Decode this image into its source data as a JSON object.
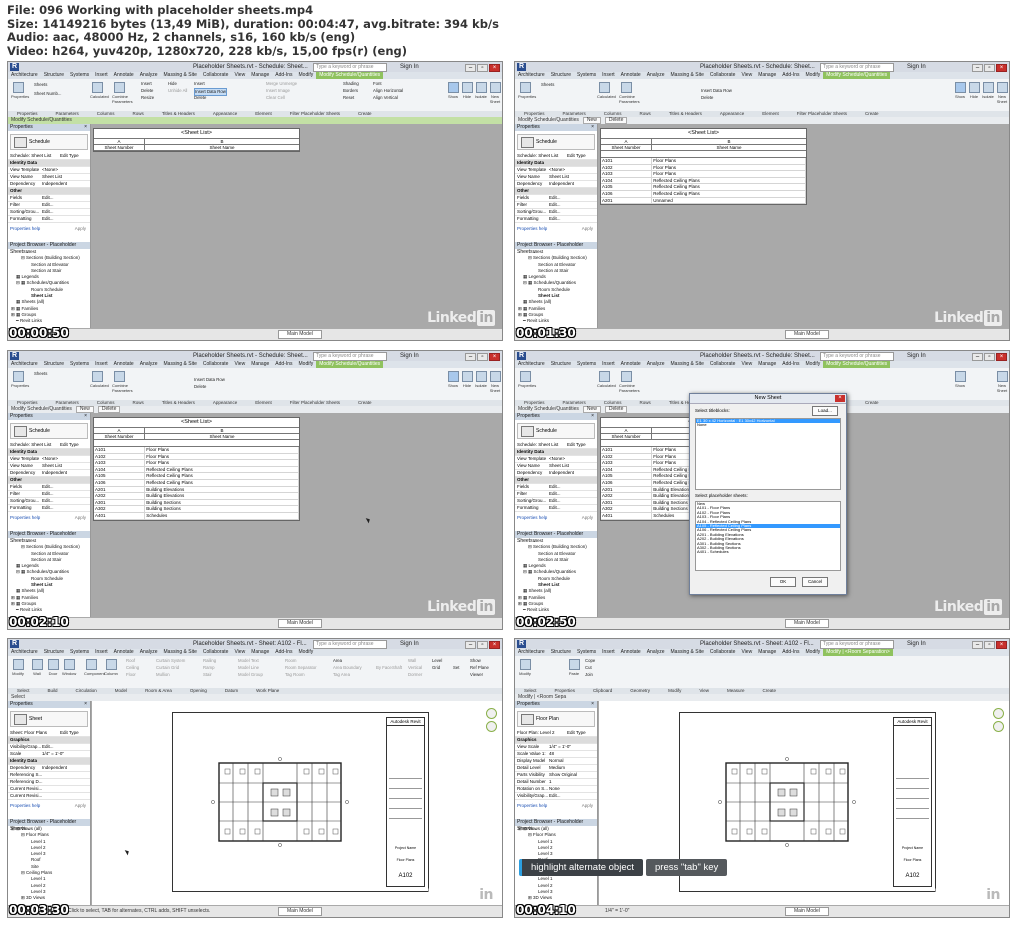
{
  "header": {
    "file": "File: 096 Working with placeholder sheets.mp4",
    "size": "Size: 14149216 bytes (13,49 MiB), duration: 00:04:47, avg.bitrate: 394 kb/s",
    "audio": "Audio: aac, 48000 Hz, 2 channels, s16, 160 kb/s (eng)",
    "video": "Video: h264, yuv420p, 1280x720, 228 kb/s, 15,00 fps(r) (eng)"
  },
  "common": {
    "logo_letter": "R",
    "title_schedule": "Placeholder Sheets.rvt - Schedule: Sheet...",
    "title_sheet": "Placeholder Sheets.rvt - Sheet: A102 - Fl...",
    "search_placeholder": "Type a keyword or phrase",
    "sign_in": "Sign In",
    "win_min": "–",
    "win_max": "▫",
    "win_close": "×",
    "watermark": "Linked",
    "watermark_in": "in",
    "main_model": "Main Model"
  },
  "ribbon": {
    "tabs_schedule": [
      "Architecture",
      "Structure",
      "Systems",
      "Insert",
      "Annotate",
      "Analyze",
      "Massing & Site",
      "Collaborate",
      "View",
      "Manage",
      "Add-Ins",
      "Modify",
      "Modify Schedule/Quantities"
    ],
    "tabs_sheet": [
      "Architecture",
      "Structure",
      "Systems",
      "Insert",
      "Annotate",
      "Analyze",
      "Massing & Site",
      "Collaborate",
      "View",
      "Manage",
      "Add-Ins",
      "Modify"
    ],
    "tabs_room": [
      "Architecture",
      "Structure",
      "Systems",
      "Insert",
      "Annotate",
      "Analyze",
      "Massing & Site",
      "Collaborate",
      "View",
      "Manage",
      "Add-Ins",
      "Modify",
      "Modify | <Room Separation>"
    ],
    "schedule_buttons": {
      "properties": "Properties",
      "sheets": "Sheets",
      "sheet_number": "Sheet Numb...",
      "calculated": "Calculated",
      "combine": "Combine Parameters",
      "insert": "Insert",
      "delete": "Delete",
      "resize": "Resize",
      "hide": "Hide",
      "unhide_all": "Unhide All",
      "insert_data_row": "Insert Data Row",
      "delete_row": "Delete",
      "insert_image": "Insert Image",
      "clear_cell": "Clear Cell",
      "merge": "Merge Unmerge",
      "group": "Group",
      "ungroup": "Ungroup",
      "shading": "Shading",
      "borders": "Borders",
      "reset": "Reset",
      "font": "Font",
      "align_h": "Align Horizontal",
      "align_v": "Align Vertical",
      "highlight": "Highlight in Model",
      "show": "Show",
      "hide_btn": "Hide",
      "isolate": "Isolate",
      "new_sheet": "New Sheet"
    },
    "panels_schedule": [
      "Properties",
      "Parameters",
      "Columns",
      "Rows",
      "Titles & Headers",
      "Appearance",
      "Element",
      "Filter Placeholder Sheets",
      "Create"
    ],
    "panels_sheet": [
      "Select",
      "Build",
      "Circulation",
      "Model",
      "Room & Area",
      "Opening",
      "Datum",
      "Work Plane"
    ],
    "panels_room": [
      "Select",
      "Properties",
      "Clipboard",
      "Geometry",
      "Modify",
      "View",
      "Measure",
      "Create"
    ],
    "sheet_tools": {
      "modify": "Modify",
      "wall": "Wall",
      "door": "Door",
      "window": "Window",
      "component": "Component",
      "column": "Column",
      "roof": "Roof",
      "ceiling": "Ceiling",
      "floor": "Floor",
      "curtain_system": "Curtain System",
      "curtain_grid": "Curtain Grid",
      "mullion": "Mullion",
      "railing": "Railing",
      "ramp": "Ramp",
      "stair": "Stair",
      "model_text": "Model Text",
      "model_line": "Model Line",
      "model_group": "Model Group",
      "room": "Room",
      "room_separator": "Room Separator",
      "tag_room": "Tag Room",
      "area": "Area",
      "area_boundary": "Area Boundary",
      "tag_area": "Tag Area",
      "by_face": "By Face",
      "shaft": "Shaft",
      "wall_opening": "Wall",
      "vertical": "Vertical",
      "dormer": "Dormer",
      "level": "Level",
      "grid": "Grid",
      "set": "Set",
      "show": "Show",
      "ref_plane": "Ref Plane",
      "viewer": "Viewer"
    },
    "room_tools": {
      "modify": "Modify",
      "paste": "Paste",
      "cope": "Cope",
      "cut": "Cut",
      "join": "Join"
    }
  },
  "optbars": {
    "schedule_plain": "Modify Schedule/Quantities",
    "schedule_newdelete": [
      "New",
      "Delete"
    ],
    "sheet_select": "Select",
    "room_sep": "Modify | <Room Sepa"
  },
  "properties": {
    "header": "Properties",
    "close": "×",
    "schedule_type": "Schedule",
    "schedule_instance": "Schedule: Sheet List",
    "edit_type": "Edit Type",
    "schedule_rows": [
      {
        "label": "Identity Data",
        "value": "",
        "cat": true
      },
      {
        "label": "View Template",
        "value": "<None>",
        "cat": false
      },
      {
        "label": "View Name",
        "value": "Sheet List",
        "cat": false
      },
      {
        "label": "Dependency",
        "value": "Independent",
        "cat": false
      },
      {
        "label": "Other",
        "value": "",
        "cat": true
      },
      {
        "label": "Fields",
        "value": "Edit...",
        "cat": false
      },
      {
        "label": "Filter",
        "value": "Edit...",
        "cat": false
      },
      {
        "label": "Sorting/Grou...",
        "value": "Edit...",
        "cat": false
      },
      {
        "label": "Formatting",
        "value": "Edit...",
        "cat": false
      }
    ],
    "help": "Properties help",
    "apply": "Apply",
    "sheet_type": "Sheet",
    "sheet_instance": "Sheet: Floor Plans",
    "sheet_rows": [
      {
        "label": "Graphics",
        "value": "",
        "cat": true
      },
      {
        "label": "Visibility/Grap...",
        "value": "Edit...",
        "cat": false
      },
      {
        "label": "Scale",
        "value": "1/4\" = 1'-0\"",
        "cat": false
      },
      {
        "label": "Identity Data",
        "value": "",
        "cat": true
      },
      {
        "label": "Dependency",
        "value": "Independent",
        "cat": false
      },
      {
        "label": "Referencing S...",
        "value": "",
        "cat": false
      },
      {
        "label": "Referencing D...",
        "value": "",
        "cat": false
      },
      {
        "label": "Current Revisi...",
        "value": "",
        "cat": false
      },
      {
        "label": "Current Revisi...",
        "value": "",
        "cat": false
      }
    ],
    "floorplan_type": "Floor Plan",
    "floorplan_instance": "Floor Plan: Level 2",
    "floorplan_rows": [
      {
        "label": "Graphics",
        "value": "",
        "cat": true
      },
      {
        "label": "View Scale",
        "value": "1/4\" = 1'-0\"",
        "cat": false
      },
      {
        "label": "Scale Value 1:",
        "value": "48",
        "cat": false
      },
      {
        "label": "Display Model",
        "value": "Normal",
        "cat": false
      },
      {
        "label": "Detail Level",
        "value": "Medium",
        "cat": false
      },
      {
        "label": "Parts Visibility",
        "value": "Show Original",
        "cat": false
      },
      {
        "label": "Detail Number",
        "value": "1",
        "cat": false
      },
      {
        "label": "Rotation on S...",
        "value": "None",
        "cat": false
      },
      {
        "label": "Visibility/Grap...",
        "value": "Edit...",
        "cat": false
      }
    ]
  },
  "project_browser": {
    "header": "Project Browser - Placeholder Sheets...",
    "schedule_tree": [
      {
        "label": "West",
        "indent": 3,
        "sel": false
      },
      {
        "label": "⊟ Sections (Building Section)",
        "indent": 2,
        "sel": false
      },
      {
        "label": "Section at Elevator",
        "indent": 4,
        "sel": false
      },
      {
        "label": "Section at Stair",
        "indent": 4,
        "sel": false
      },
      {
        "label": "▦ Legends",
        "indent": 1,
        "sel": false
      },
      {
        "label": "⊟ ▦ Schedules/Quantities",
        "indent": 1,
        "sel": false
      },
      {
        "label": "Room Schedule",
        "indent": 4,
        "sel": false
      },
      {
        "label": "Sheet List",
        "indent": 4,
        "sel": true
      },
      {
        "label": "▦ Sheets (all)",
        "indent": 1,
        "sel": false
      },
      {
        "label": "⊞ ▦ Families",
        "indent": 0,
        "sel": false
      },
      {
        "label": "⊞ ▦ Groups",
        "indent": 0,
        "sel": false
      },
      {
        "label": "━ Revit Links",
        "indent": 1,
        "sel": false
      }
    ],
    "sheet_tree": [
      {
        "label": "⊟ ⊠ Views (all)",
        "indent": 0,
        "sel": false
      },
      {
        "label": "⊟ Floor Plans",
        "indent": 2,
        "sel": false
      },
      {
        "label": "Level 1",
        "indent": 4,
        "sel": false
      },
      {
        "label": "Level 2",
        "indent": 4,
        "sel": false
      },
      {
        "label": "Level 3",
        "indent": 4,
        "sel": false
      },
      {
        "label": "Roof",
        "indent": 4,
        "sel": false
      },
      {
        "label": "Site",
        "indent": 4,
        "sel": false
      },
      {
        "label": "⊟ Ceiling Plans",
        "indent": 2,
        "sel": false
      },
      {
        "label": "Level 1",
        "indent": 4,
        "sel": false
      },
      {
        "label": "Level 2",
        "indent": 4,
        "sel": false
      },
      {
        "label": "Level 3",
        "indent": 4,
        "sel": false
      },
      {
        "label": "⊞ 3D Views",
        "indent": 2,
        "sel": false
      }
    ]
  },
  "schedule": {
    "title": "<Sheet List>",
    "col_a": "A",
    "col_b": "B",
    "col_a_name": "Sheet Number",
    "col_b_name": "Sheet Name",
    "rows_f2": [
      [
        "A101",
        "Floor Plans"
      ],
      [
        "A102",
        "Floor Plans"
      ],
      [
        "A103",
        "Floor Plans"
      ],
      [
        "A104",
        "Reflected Ceiling Plans"
      ],
      [
        "A105",
        "Reflected Ceiling Plans"
      ],
      [
        "A106",
        "Reflected Ceiling Plans"
      ],
      [
        "A201",
        "Unnamed"
      ]
    ],
    "rows_full": [
      [
        "A101",
        "Floor Plans"
      ],
      [
        "A102",
        "Floor Plans"
      ],
      [
        "A103",
        "Floor Plans"
      ],
      [
        "A104",
        "Reflected Ceiling Plans"
      ],
      [
        "A105",
        "Reflected Ceiling Plans"
      ],
      [
        "A106",
        "Reflected Ceiling Plans"
      ],
      [
        "A201",
        "Building Elevations"
      ],
      [
        "A202",
        "Building Elevations"
      ],
      [
        "A301",
        "Building Sections"
      ],
      [
        "A302",
        "Building Sections"
      ],
      [
        "A401",
        "Schedules"
      ]
    ]
  },
  "new_sheet_dialog": {
    "title": "New Sheet",
    "close": "×",
    "select_titleblocks": "Select titleblocks:",
    "load": "Load...",
    "titleblocks": [
      "E1 30 x 42 Horizontal : E1 30x42 Horizontal",
      "None"
    ],
    "select_placeholder": "Select placeholder sheets:",
    "placeholders": [
      "New",
      "A101 - Floor Plans",
      "A102 - Floor Plans",
      "A103 - Floor Plans",
      "A104 - Reflected Ceiling Plans",
      "A105 - Reflected Ceiling Plans",
      "A106 - Reflected Ceiling Plans",
      "A201 - Building Elevations",
      "A202 - Building Elevations",
      "A301 - Building Sections",
      "A302 - Building Sections",
      "A401 - Schedules"
    ],
    "selected_placeholder_index": 5,
    "ok": "OK",
    "cancel": "Cancel"
  },
  "sheet_view": {
    "tb_name": "Autodesk Revit",
    "project_name": "Project Name",
    "sheet_title": "Floor Plans",
    "sheet_number": "A102"
  },
  "status_text": "Click to select, TAB for alternates, CTRL adds, SHIFT unselects.",
  "scale_label": "1/4\" = 1'-0\"",
  "hints": [
    "highlight alternate object",
    "press \"tab\" key"
  ],
  "timecodes": [
    "00:00:50",
    "00:01:30",
    "00:02:10",
    "00:02:50",
    "00:03:30",
    "00:04:10"
  ]
}
